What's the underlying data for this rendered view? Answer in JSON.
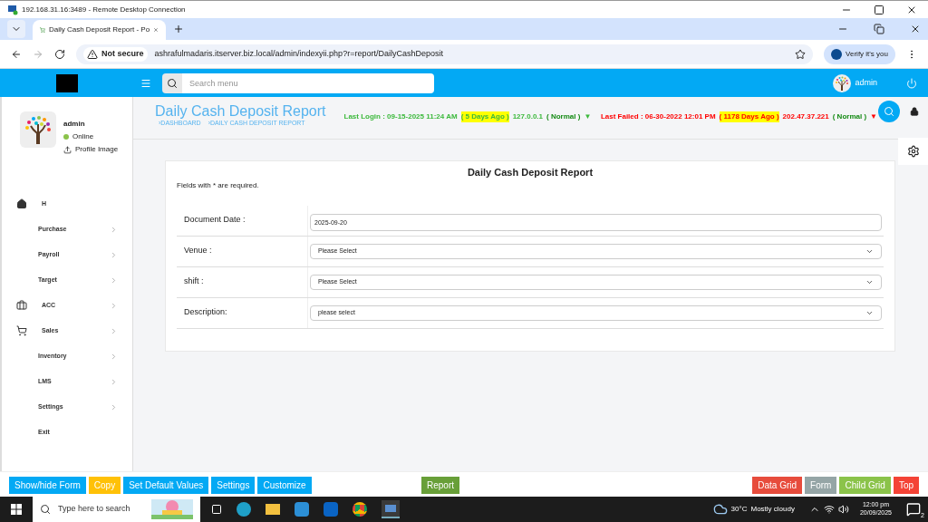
{
  "remote_window": {
    "title": "192.168.31.16:3489 - Remote Desktop Connection"
  },
  "browser": {
    "tab_title": "Daily Cash Deposit Report - Po",
    "security": "Not secure",
    "url": "ashrafulmadaris.itserver.biz.local/admin/indexyii.php?r=report/DailyCashDeposit",
    "profile_button": "Verify it's you"
  },
  "app_header": {
    "search_placeholder": "Search menu",
    "user": "admin"
  },
  "sidebar": {
    "user": "admin",
    "status": "Online",
    "profile_link": "Profile Image",
    "items": [
      {
        "label": "H",
        "kind": "home",
        "expandable": false
      },
      {
        "label": "Purchase",
        "kind": "item",
        "expandable": true
      },
      {
        "label": "Payroll",
        "kind": "item",
        "expandable": true
      },
      {
        "label": "Target",
        "kind": "item",
        "expandable": true
      },
      {
        "label": "ACC",
        "kind": "accounts",
        "expandable": true
      },
      {
        "label": "Sales",
        "kind": "sales",
        "expandable": true
      },
      {
        "label": "Inventory",
        "kind": "item",
        "expandable": true
      },
      {
        "label": "LMS",
        "kind": "item",
        "expandable": true
      },
      {
        "label": "Settings",
        "kind": "item",
        "expandable": true
      },
      {
        "label": "Exit",
        "kind": "item",
        "expandable": false
      }
    ]
  },
  "page_header": {
    "title": "Daily Cash Deposit Report",
    "breadcrumbs": [
      "›DASHBOARD",
      "›DAILY CASH DEPOSIT REPORT"
    ],
    "last_login": {
      "text": "Last Login : 09-15-2025 11:24 AM",
      "ago": "( 5 Days Ago )",
      "ip": "127.0.0.1",
      "status": "( Normal )",
      "marker": "▼"
    },
    "last_failed": {
      "text": "Last Failed : 06-30-2022 12:01 PM",
      "ago": "( 1178 Days Ago )",
      "ip": "202.47.37.221",
      "status": "( Normal )",
      "marker": "▼"
    }
  },
  "form": {
    "title": "Daily Cash Deposit Report",
    "note": "Fields with * are required.",
    "fields": [
      {
        "label": "Document Date :",
        "kind": "text",
        "value": "2025-09-20"
      },
      {
        "label": "Venue :",
        "kind": "select",
        "value": "Please Select"
      },
      {
        "label": "shift :",
        "kind": "select",
        "value": "Please Select"
      },
      {
        "label": "Description:",
        "kind": "select",
        "value": "please select"
      }
    ]
  },
  "left_buttons": [
    {
      "label": "Show/hide Form",
      "color": "#03a9f4"
    },
    {
      "label": "Copy",
      "color": "#ffc107"
    },
    {
      "label": "Set Default Values",
      "color": "#03a9f4"
    },
    {
      "label": "Settings",
      "color": "#03a9f4"
    },
    {
      "label": "Customize",
      "color": "#03a9f4"
    }
  ],
  "center_button": {
    "label": "Report",
    "color": "#689f38"
  },
  "right_buttons": [
    {
      "label": "Data Grid",
      "color": "#e74c3c"
    },
    {
      "label": "Form",
      "color": "#95a5a6"
    },
    {
      "label": "Child Grid",
      "color": "#8bc34a"
    },
    {
      "label": "Top",
      "color": "#f44336"
    }
  ],
  "taskbar": {
    "search_placeholder": "Type here to search",
    "temperature": "30°C",
    "weather": "Mostly cloudy",
    "time": "12:00 pm",
    "date": "20/09/2025",
    "notifications": "2"
  }
}
